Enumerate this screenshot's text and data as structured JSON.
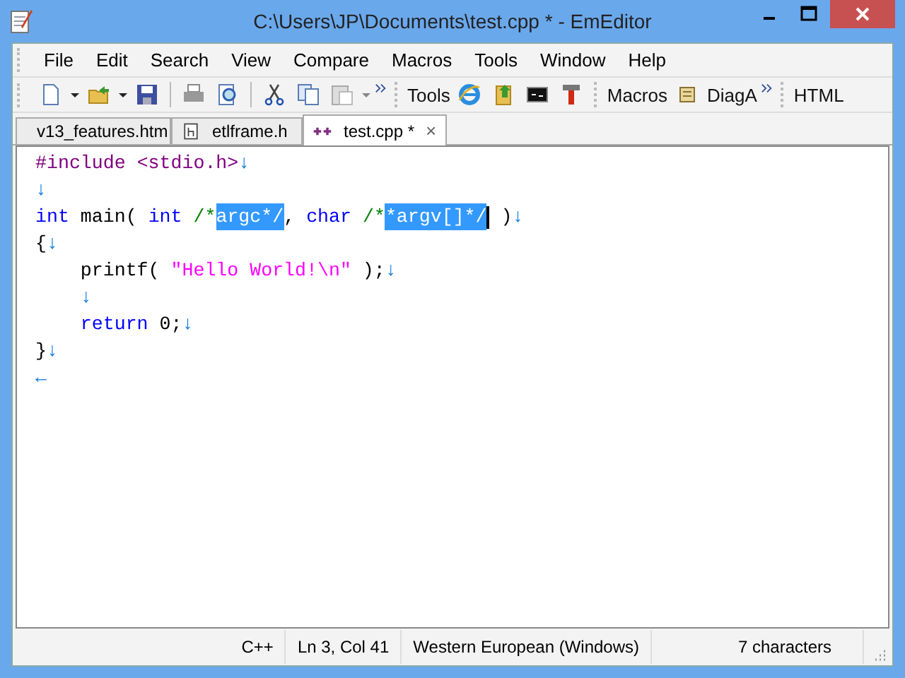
{
  "window": {
    "title": "C:\\Users\\JP\\Documents\\test.cpp * - EmEditor"
  },
  "menu": [
    "File",
    "Edit",
    "Search",
    "View",
    "Compare",
    "Macros",
    "Tools",
    "Window",
    "Help"
  ],
  "toolbar_labels": {
    "tools": "Tools",
    "macros": "Macros",
    "diag": "DiagA",
    "html": "HTML"
  },
  "tabs": [
    {
      "label": "v13_features.htm",
      "kind": "web",
      "selected": false
    },
    {
      "label": "etlframe.h",
      "kind": "header",
      "selected": false
    },
    {
      "label": "test.cpp *",
      "kind": "cpp",
      "selected": true,
      "close": "×"
    }
  ],
  "editor": {
    "lines": [
      {
        "indented": false,
        "tokens": [
          {
            "text": "#include <stdio.h>",
            "kind": "preprocessor"
          },
          {
            "text": "↓",
            "kind": "mark"
          }
        ]
      },
      {
        "indented": false,
        "tokens": [
          {
            "text": "↓",
            "kind": "mark"
          }
        ]
      },
      {
        "indented": false,
        "tokens": [
          {
            "text": "int",
            "kind": "keyword"
          },
          {
            "text": " main( ",
            "kind": "plain"
          },
          {
            "text": "int",
            "kind": "keyword"
          },
          {
            "text": " /*",
            "kind": "comment"
          },
          {
            "text": "argc*/",
            "kind": "comment",
            "selected": true
          },
          {
            "text": ", ",
            "kind": "plain"
          },
          {
            "text": "char",
            "kind": "keyword"
          },
          {
            "text": " /*",
            "kind": "comment"
          },
          {
            "text": "*argv[]*/",
            "kind": "comment",
            "selected": true,
            "caret": true
          },
          {
            "text": " )",
            "kind": "plain"
          },
          {
            "text": "↓",
            "kind": "mark"
          }
        ]
      },
      {
        "indented": false,
        "tokens": [
          {
            "text": "{",
            "kind": "plain"
          },
          {
            "text": "↓",
            "kind": "mark"
          }
        ]
      },
      {
        "indented": true,
        "tokens": [
          {
            "text": "printf( ",
            "kind": "plain"
          },
          {
            "text": "\"Hello World!\\n\"",
            "kind": "string"
          },
          {
            "text": " );",
            "kind": "plain"
          },
          {
            "text": "↓",
            "kind": "mark"
          }
        ]
      },
      {
        "indented": true,
        "tokens": [
          {
            "text": "↓",
            "kind": "mark"
          }
        ]
      },
      {
        "indented": true,
        "tokens": [
          {
            "text": "return",
            "kind": "keyword"
          },
          {
            "text": " 0;",
            "kind": "plain"
          },
          {
            "text": "↓",
            "kind": "mark"
          }
        ]
      },
      {
        "indented": false,
        "tokens": [
          {
            "text": "}",
            "kind": "plain"
          },
          {
            "text": "↓",
            "kind": "mark"
          }
        ]
      },
      {
        "indented": false,
        "tokens": [
          {
            "text": "←",
            "kind": "mark"
          }
        ]
      }
    ]
  },
  "status_bar": [
    "C++",
    "Ln 3, Col 41",
    "Western European (Windows)",
    "7 characters"
  ]
}
